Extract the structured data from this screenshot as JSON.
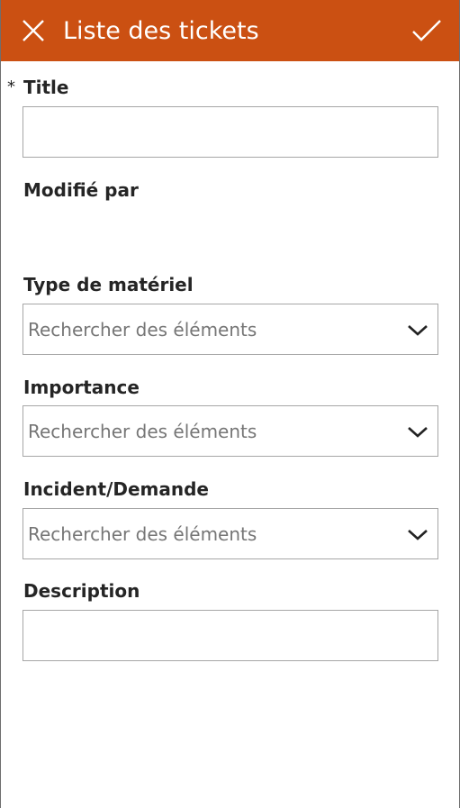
{
  "header": {
    "title": "Liste des tickets",
    "background_color": "#cb5012",
    "close_icon": "close-icon",
    "submit_icon": "checkmark-icon"
  },
  "form": {
    "required_marker": "*",
    "title_label": "Title",
    "title_value": "",
    "modified_by_label": "Modifié par",
    "modified_by_value": "",
    "material_type_label": "Type de matériel",
    "material_type_placeholder": "Rechercher des éléments",
    "importance_label": "Importance",
    "importance_placeholder": "Rechercher des éléments",
    "incident_label": "Incident/Demande",
    "incident_placeholder": "Rechercher des éléments",
    "description_label": "Description",
    "description_value": ""
  }
}
